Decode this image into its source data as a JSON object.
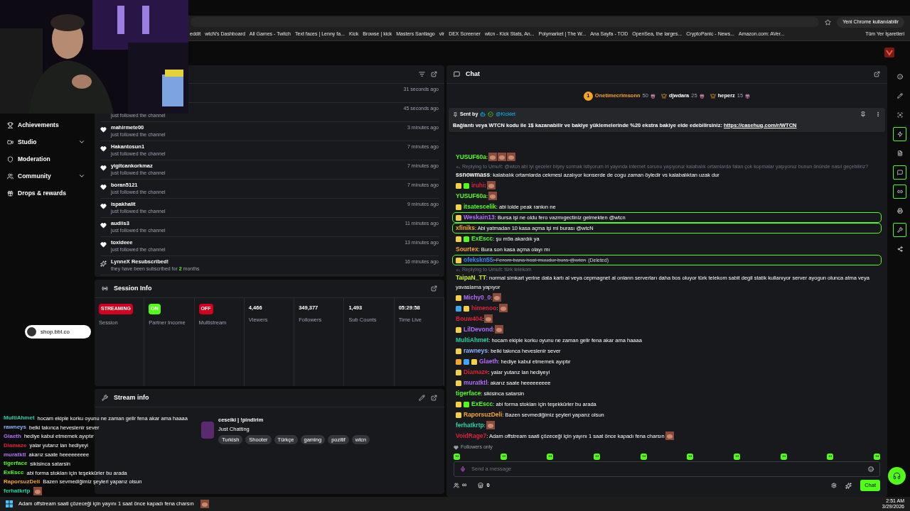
{
  "browser": {
    "update_button": "Yeni Chrome kullanılabilir",
    "bookmarks": [
      "eddit",
      "wtcN's Dashboard",
      "All Games - Twitch",
      "Text faces | Lenny fa...",
      "Kick",
      "Browse | kick",
      "Masters Santiago",
      "vlr",
      "DEX Screener",
      "wtcn - Kick Stats, An...",
      "Polymarket | The W...",
      "Ana Sayfa - TOD",
      "OpenSea, the larges...",
      "CryptoPanic - News...",
      "Amazon.com: AVer..."
    ],
    "all_bookmarks": "Tüm Yer İşaretleri"
  },
  "sidebar": {
    "items": [
      {
        "label": "Achievements",
        "has_submenu": false
      },
      {
        "label": "Studio",
        "has_submenu": true
      },
      {
        "label": "Moderation",
        "has_submenu": false
      },
      {
        "label": "Community",
        "has_submenu": true
      },
      {
        "label": "Drops & rewards",
        "has_submenu": false
      }
    ]
  },
  "overlay_link": "shop.bbl.co",
  "activity": {
    "items": [
      {
        "time": "31 seconds ago"
      },
      {
        "detail": "just followed the channel",
        "time": "45 seconds ago"
      },
      {
        "kind": "follow",
        "name": "mahirmete00",
        "detail": "just followed the channel",
        "time": "3 minutes ago"
      },
      {
        "kind": "follow",
        "name": "Hakantosun1",
        "detail": "just followed the channel",
        "time": "7 minutes ago"
      },
      {
        "kind": "follow",
        "name": "yigitcankorkmaz",
        "detail": "just followed the channel",
        "time": "7 minutes ago"
      },
      {
        "kind": "follow",
        "name": "boran5121",
        "detail": "just followed the channel",
        "time": "7 minutes ago"
      },
      {
        "kind": "follow",
        "name": "ispakhalit",
        "detail": "just followed the channel",
        "time": "9 minutes ago"
      },
      {
        "kind": "follow",
        "name": "audiis3",
        "detail": "just followed the channel",
        "time": "11 minutes ago"
      },
      {
        "kind": "follow",
        "name": "toxideee",
        "detail": "just followed the channel",
        "time": "13 minutes ago"
      },
      {
        "kind": "sub",
        "name": "LynneX Resubscribed!",
        "detail": "they have been subscribed for **2** months",
        "time": "16 minutes ago"
      }
    ]
  },
  "session_info": {
    "title": "Session Info",
    "stats": [
      {
        "kind": "badge",
        "value": "STREAMING",
        "color": "#d2001f",
        "label": "Session"
      },
      {
        "kind": "badge",
        "value": "ON",
        "color": "#53fc18",
        "label": "Partner Income"
      },
      {
        "kind": "badge",
        "value": "OFF",
        "color": "#d2001f",
        "label": "Multistream"
      },
      {
        "kind": "number",
        "value": "4,466",
        "label": "Viewers"
      },
      {
        "kind": "number",
        "value": "349,377",
        "label": "Followers"
      },
      {
        "kind": "number",
        "value": "1,493",
        "label": "Sub Counts"
      },
      {
        "kind": "number",
        "value": "05:29:58",
        "label": "Time Live"
      }
    ]
  },
  "stream_info": {
    "title": "Stream info",
    "stream_title": "ceseiki | !pindirim",
    "category": "Just Chatting",
    "tags": [
      "Turkish",
      "Shooter",
      "Türkçe",
      "gaming",
      "pozitif",
      "wtcn"
    ]
  },
  "chat": {
    "title": "Chat",
    "gifters": [
      {
        "rank": "1",
        "name": "Onetimecrimsonn",
        "count": "50"
      },
      {
        "name": "djwdara",
        "count": "25"
      },
      {
        "name": "heperz",
        "count": "15"
      }
    ],
    "pinned": {
      "sent_by": "Sent by",
      "author": "@Kicklet",
      "text": "Bağlantı veya WTCN kodu ile 1$ kazanabilir ve bakiye yüklemelerinde %20 ekstra bakiye elde edebilirsiniz: ",
      "link": "https://casehug.com/r/WTCN"
    },
    "messages": [
      {
        "user": "YUSUF60a",
        "color": "#53fc18",
        "text": ":",
        "emotes": [
          {
            "kind": "emote"
          },
          {
            "kind": "emote"
          },
          {
            "kind": "emote"
          }
        ],
        "highlighted": false,
        "deleted": false
      },
      {
        "reply": "Replying to Umu!t: @wtcn abi iyi geceler bişey sormak istiyorum iri yayında internet sorunu yaşıyoruz kalabalık ortamlarda falan çok kopmalar yaşıyoruz bunun önünde nasıl geçebiliriz?",
        "user": "ssnowmass",
        "color": "#ffffff",
        "text": ": kalabalık ortamlarda cekmesi azalıyor konserde de cogu zaman öyledir vs kalabalıktan uzak dur",
        "highlighted": false,
        "deleted": false
      },
      {
        "user": "iruhi",
        "color": "#e01f3d",
        "text": ":",
        "badges": [
          {
            "kind": "sub"
          },
          {
            "kind": "gift"
          }
        ],
        "emotes": [
          {
            "kind": "emote"
          }
        ],
        "highlighted": false,
        "deleted": false
      },
      {
        "user": "YUSUF60a",
        "color": "#53fc18",
        "text": ":",
        "emotes": [
          {
            "kind": "emote"
          }
        ],
        "highlighted": false,
        "deleted": false
      },
      {
        "user": "itsatescelik",
        "color": "#53fc18",
        "text": ": abi lolde peak rankın ne",
        "badges": [
          {
            "kind": "sub"
          }
        ],
        "highlighted": false,
        "deleted": false
      },
      {
        "user": "Weskain13",
        "color": "#b16cff",
        "text": ": Bursa işi ne oldu fero vazmıgectiniz gelmekten @wtcn",
        "badges": [
          {
            "kind": "sub"
          }
        ],
        "highlighted": true,
        "deleted": false
      },
      {
        "user": "xfiniks",
        "color": "#f5a623",
        "text": ": Abi yatmadan 10 kasa açma işi mi burası @wtcN",
        "highlighted": true,
        "deleted": false
      },
      {
        "user": "ExEscc",
        "color": "#53fc18",
        "text": ": şu m9a akardık ya",
        "badges": [
          {
            "kind": "sub"
          },
          {
            "kind": "gift"
          }
        ],
        "highlighted": false,
        "deleted": false
      },
      {
        "user": "Sourtex",
        "color": "#f5a623",
        "text": ": Bura son kasa açma olayı mı",
        "highlighted": false,
        "deleted": false
      },
      {
        "user": "ofekskn55",
        "color": "#3b82f6",
        "text": ": Ferom bana host muudur bura @wtcn",
        "deleted_label": "(Deleted)",
        "badges": [
          {
            "kind": "sub"
          }
        ],
        "highlighted": true,
        "deleted": true
      },
      {
        "reply": "Replying to Umu!t: türk telekom",
        "user": "TaipaN_TT",
        "color": "#c6f31a",
        "text": ": normal simkart yerine data kartı al veya cepmagnet al onların serverları daha bos oluyor türk telekom sabit degil statik kullanıyor server ayogun olunca atma veya yavaslama yapıyor",
        "highlighted": false,
        "deleted": false
      },
      {
        "user": "Michy0_0",
        "color": "#b16cff",
        "text": ":",
        "badges": [
          {
            "kind": "sub"
          }
        ],
        "emotes": [
          {
            "kind": "emote"
          }
        ],
        "highlighted": false,
        "deleted": false
      },
      {
        "user": "himenoo",
        "color": "#e01f3d",
        "text": ":",
        "badges": [
          {
            "kind": "mod"
          },
          {
            "kind": "sub"
          }
        ],
        "emotes": [
          {
            "kind": "emote"
          }
        ],
        "highlighted": false,
        "deleted": false
      },
      {
        "user": "Bouw404",
        "color": "#e01f3d",
        "text": ":",
        "emotes": [
          {
            "kind": "emote"
          }
        ],
        "highlighted": false,
        "deleted": false
      },
      {
        "user": "LilDevond",
        "color": "#b16cff",
        "text": ":",
        "badges": [
          {
            "kind": "sub"
          }
        ],
        "emotes": [
          {
            "kind": "emote"
          }
        ],
        "highlighted": false,
        "deleted": false
      },
      {
        "user": "MultiAhmet",
        "color": "#1fd1a5",
        "text": ": hocam ekiple korku oyunu ne zaman gelir fena akar ama haaaa",
        "highlighted": false,
        "deleted": false
      },
      {
        "user": "rawneys",
        "color": "#8ab4f8",
        "text": ": belki takınca heveslenir sever",
        "badges": [
          {
            "kind": "sub"
          }
        ],
        "highlighted": false,
        "deleted": false
      },
      {
        "user": "Glaeth",
        "color": "#b16cff",
        "text": ": hediye kabul etmemek ayıptır",
        "badges": [
          {
            "kind": "crown"
          },
          {
            "kind": "mod"
          },
          {
            "kind": "sub"
          }
        ],
        "highlighted": false,
        "deleted": false
      },
      {
        "user": "Diamaze",
        "color": "#e01f3d",
        "text": ": yalar yutarız lan hediyeyi",
        "badges": [
          {
            "kind": "sub"
          }
        ],
        "highlighted": false,
        "deleted": false
      },
      {
        "user": "muratktl",
        "color": "#b16cff",
        "text": ": akarız saate heeeeeeeee",
        "badges": [
          {
            "kind": "sub"
          }
        ],
        "highlighted": false,
        "deleted": false
      },
      {
        "user": "tigerface",
        "color": "#53fc18",
        "text": ": sikisinca satarsin",
        "highlighted": false,
        "deleted": false
      },
      {
        "user": "ExEscc",
        "color": "#53fc18",
        "text": ": abi forma stokları için teşekkürler bu arada",
        "badges": [
          {
            "kind": "sub"
          },
          {
            "kind": "gift"
          }
        ],
        "highlighted": false,
        "deleted": false
      },
      {
        "user": "RaporsuzDeli",
        "color": "#f5a623",
        "text": ": Bazen sevmediğimiz şeyleri yaparız olsun",
        "badges": [
          {
            "kind": "sub"
          }
        ],
        "highlighted": false,
        "deleted": false
      },
      {
        "user": "ferhatkrtp",
        "color": "#1fd1a5",
        "text": ":",
        "emotes": [
          {
            "kind": "emote"
          }
        ],
        "highlighted": false,
        "deleted": false
      },
      {
        "user": "VoidRage7",
        "color": "#e01f3d",
        "text": ": Adam offstream saati çözeceği için yayını 1 saat önce kapadı fena charsın",
        "emotes": [
          {
            "kind": "emote"
          }
        ],
        "highlighted": false,
        "deleted": false
      }
    ],
    "followers_only": "Followers only",
    "input": {
      "placeholder": "Send a message"
    },
    "infinity": "∞",
    "shop_count": "0",
    "send_button": "Chat"
  },
  "rail": [
    {
      "kind": "info",
      "active": false
    },
    {
      "kind": "pencil",
      "active": false
    },
    {
      "kind": "focus",
      "active": false
    },
    {
      "kind": "zap",
      "active": true
    },
    {
      "kind": "file",
      "active": false
    },
    {
      "kind": "message",
      "active": true
    },
    {
      "kind": "link",
      "active": true
    },
    {
      "kind": "printer",
      "active": false
    },
    {
      "kind": "wrench",
      "active": true
    },
    {
      "kind": "share",
      "active": false
    }
  ],
  "stream_overlay": {
    "messages": [
      {
        "user": "MultiAhmet",
        "color": "#1fd1a5",
        "text": "hocam ekiple korku oyunu ne zaman gelir fena akar ama haaaa"
      },
      {
        "user": "rawneys",
        "color": "#8ab4f8",
        "text": "belki takınca heveslenir sever"
      },
      {
        "user": "Glaeth",
        "color": "#b16cff",
        "text": "hediye kabul etmemek ayıptır"
      },
      {
        "user": "Diamaze",
        "color": "#e01f3d",
        "text": "yalar yutarız lan hediyeyi"
      },
      {
        "user": "muratktl",
        "color": "#b16cff",
        "text": "akarız saate heeeeeeeee"
      },
      {
        "user": "tigerface",
        "color": "#53fc18",
        "text": "sikisinca satarsin"
      },
      {
        "user": "ExEscc",
        "color": "#53fc18",
        "text": "abi forma stokları için teşekkürler bu arada"
      },
      {
        "user": "RaporsuzDeli",
        "color": "#f5a623",
        "text": "Bazen sevmediğimiz şeyleri yaparız olsun"
      },
      {
        "user": "ferhatkrtp",
        "color": "#1fd1a5",
        "emotes": [
          {
            "kind": "emote"
          }
        ]
      }
    ],
    "last_line": "Adam offstream saati çözeceği için yayını 1 saat önce kapadı fena charsın"
  },
  "taskbar": {
    "time": "2:51 AM",
    "date": "3/29/2026"
  }
}
